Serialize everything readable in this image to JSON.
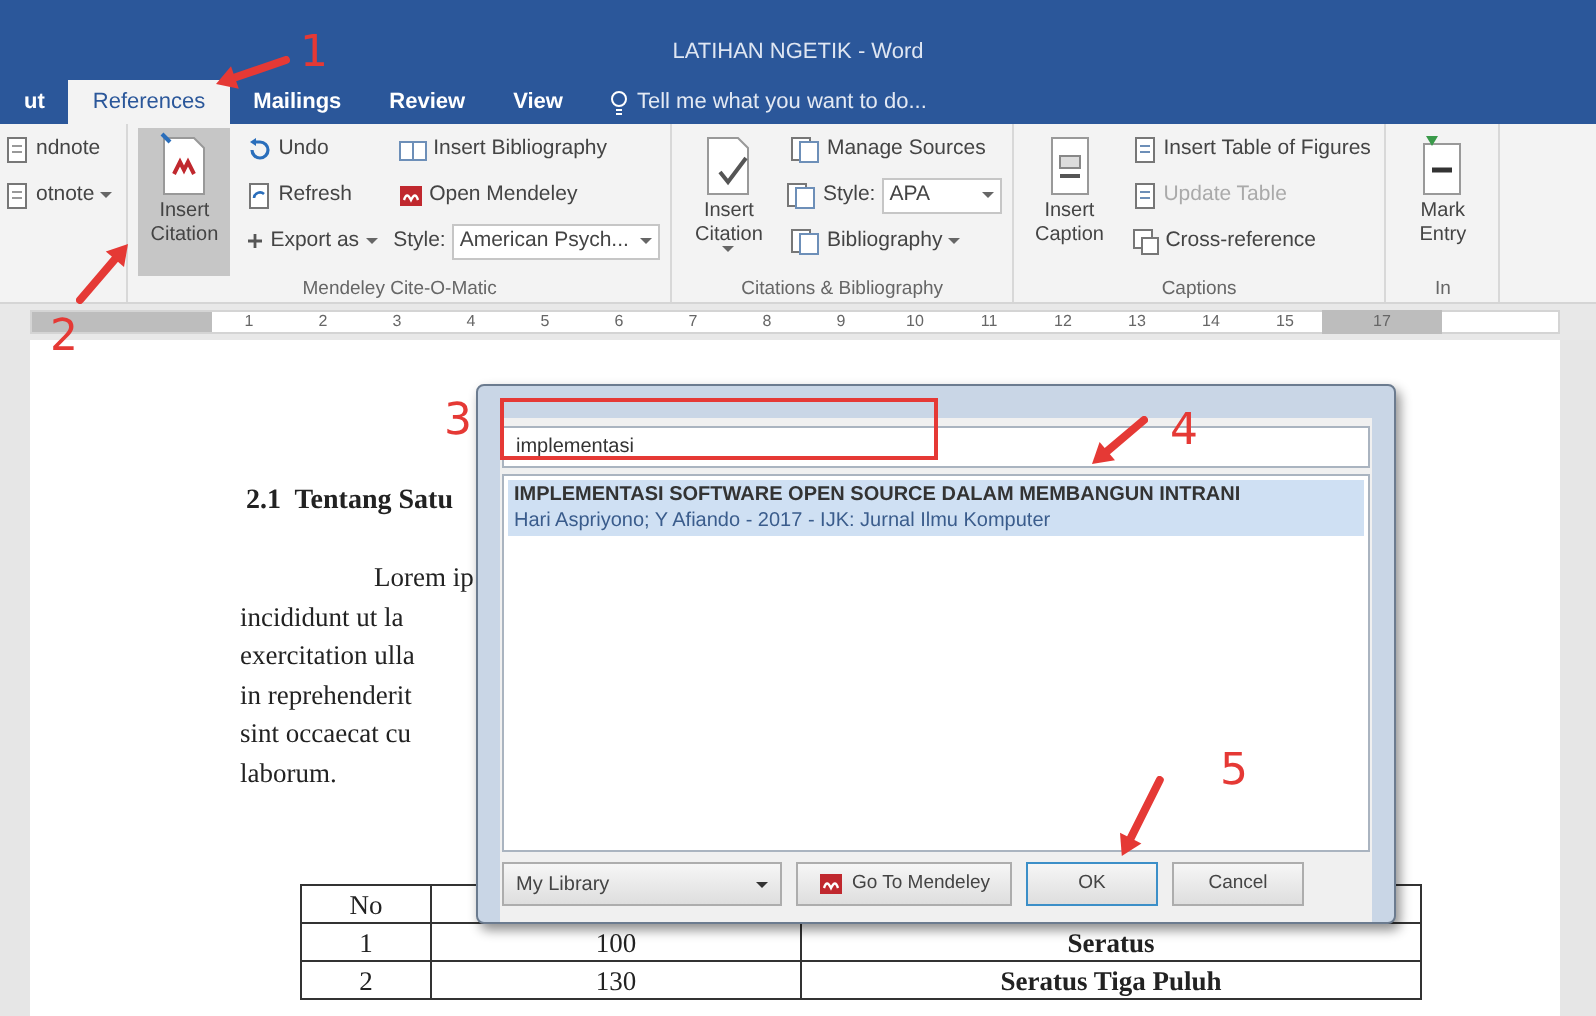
{
  "window": {
    "title": "LATIHAN NGETIK - Word"
  },
  "tabs": [
    {
      "label": "ut",
      "selected": false
    },
    {
      "label": "References",
      "selected": true
    },
    {
      "label": "Mailings",
      "selected": false
    },
    {
      "label": "Review",
      "selected": false
    },
    {
      "label": "View",
      "selected": false
    }
  ],
  "tell_me": {
    "placeholder": "Tell me what you want to do..."
  },
  "ribbon": {
    "groups": [
      {
        "columns": [
          [
            {
              "kind": "small",
              "label": "ndnote",
              "disabled": false
            },
            {
              "kind": "small",
              "label": "otnote",
              "dropdown": true,
              "disabled": false
            }
          ]
        ]
      },
      {
        "label": "Mendeley Cite-O-Matic",
        "columns": [
          [
            {
              "kind": "large",
              "label": "Insert Citation",
              "selected": true
            }
          ],
          [
            {
              "kind": "small",
              "label": "Undo",
              "disabled": false
            },
            {
              "kind": "small",
              "label": "Refresh",
              "disabled": false
            },
            {
              "kind": "small",
              "label": "Export as",
              "dropdown": true,
              "disabled": false
            }
          ],
          [
            {
              "kind": "small",
              "label": "Insert Bibliography",
              "disabled": false
            },
            {
              "kind": "small",
              "label": "Open Mendeley",
              "disabled": false
            },
            {
              "kind": "combo",
              "label": "Style:",
              "value": "American Psych..."
            }
          ]
        ]
      },
      {
        "label": "Citations & Bibliography",
        "columns": [
          [
            {
              "kind": "large",
              "label": "Insert Citation",
              "dropdown": true,
              "selected": false
            }
          ],
          [
            {
              "kind": "small",
              "label": "Manage Sources",
              "disabled": false
            },
            {
              "kind": "combo",
              "label": "Style:",
              "value": "APA"
            },
            {
              "kind": "small",
              "label": "Bibliography",
              "dropdown": true,
              "disabled": false
            }
          ]
        ]
      },
      {
        "label": "Captions",
        "columns": [
          [
            {
              "kind": "large",
              "label": "Insert Caption",
              "selected": false
            }
          ],
          [
            {
              "kind": "small",
              "label": "Insert Table of Figures",
              "disabled": false
            },
            {
              "kind": "small",
              "label": "Update Table",
              "disabled": true
            },
            {
              "kind": "small",
              "label": "Cross-reference",
              "disabled": false
            }
          ]
        ]
      },
      {
        "label": "In",
        "columns": [
          [
            {
              "kind": "large",
              "label": "Mark Entry",
              "selected": false
            }
          ]
        ]
      }
    ]
  },
  "ruler": {
    "labels": [
      "1",
      "2",
      "3",
      "4",
      "5",
      "6",
      "7",
      "8",
      "9",
      "10",
      "11",
      "12",
      "13",
      "14",
      "15",
      "17"
    ]
  },
  "document": {
    "heading": "2.1  Tentang Satu",
    "paragraph": [
      "Lorem ip",
      "incididunt ut la",
      "exercitation ulla",
      "in reprehenderit",
      "sint occaecat cu",
      "laborum."
    ],
    "table": {
      "columns": [
        "No"
      ],
      "rows": [
        [
          "1",
          "100",
          "Seratus"
        ],
        [
          "2",
          "130",
          "Seratus Tiga Puluh"
        ]
      ]
    }
  },
  "dialog": {
    "search": {
      "value": "implementasi"
    },
    "results": [
      {
        "title": "IMPLEMENTASI SOFTWARE OPEN SOURCE DALAM MEMBANGUN INTRANI",
        "details": "Hari Aspriyono; Y Afiando - 2017 - IJK: Jurnal Ilmu Komputer",
        "selected": true
      }
    ],
    "library": "My Library",
    "buttons": [
      "Go To Mendeley",
      "OK",
      "Cancel"
    ]
  },
  "annotations": [
    "1",
    "2",
    "3",
    "4",
    "5"
  ]
}
